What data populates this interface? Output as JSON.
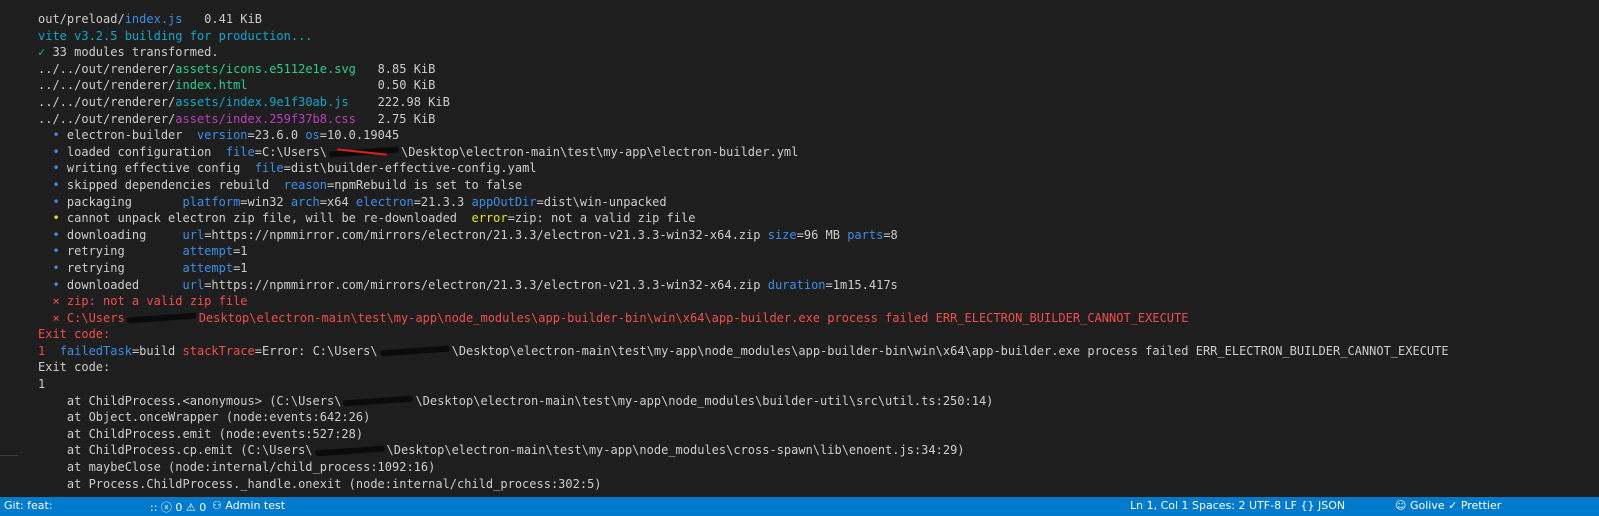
{
  "terminal": {
    "lines": [
      [
        {
          "t": "out/preload/",
          "c": "w"
        },
        {
          "t": "index.js",
          "c": "b"
        },
        {
          "t": "   0.41 KiB",
          "c": "w"
        }
      ],
      [
        {
          "t": "vite v3.2.5 building for production...",
          "c": "c"
        }
      ],
      [
        {
          "t": "✓",
          "c": "gr"
        },
        {
          "t": " 33 modules transformed.",
          "c": "w"
        }
      ],
      [
        {
          "t": "../../out/renderer/",
          "c": "w"
        },
        {
          "t": "assets/icons.e5112e1e.svg",
          "c": "g"
        },
        {
          "t": "   8.85 KiB",
          "c": "w"
        }
      ],
      [
        {
          "t": "../../out/renderer/",
          "c": "w"
        },
        {
          "t": "index.html",
          "c": "g"
        },
        {
          "t": "                  0.50 KiB",
          "c": "w"
        }
      ],
      [
        {
          "t": "../../out/renderer/",
          "c": "w"
        },
        {
          "t": "assets/index.9e1f30ab.js",
          "c": "c"
        },
        {
          "t": "    222.98 KiB",
          "c": "w"
        }
      ],
      [
        {
          "t": "../../out/renderer/",
          "c": "w"
        },
        {
          "t": "assets/index.259f37b8.css",
          "c": "m"
        },
        {
          "t": "   2.75 KiB",
          "c": "w"
        }
      ],
      [
        {
          "t": "  • ",
          "c": "b"
        },
        {
          "t": "electron-builder  ",
          "c": "w"
        },
        {
          "t": "version",
          "c": "b"
        },
        {
          "t": "=23.6.0 ",
          "c": "w"
        },
        {
          "t": "os",
          "c": "b"
        },
        {
          "t": "=10.0.19045",
          "c": "w"
        }
      ],
      [
        {
          "t": "  • ",
          "c": "b"
        },
        {
          "t": "loaded configuration  ",
          "c": "w"
        },
        {
          "t": "file",
          "c": "b"
        },
        {
          "t": "=C:\\Users\\",
          "c": "w"
        },
        {
          "redact": "red"
        },
        {
          "t": "\\Desktop\\electron-main\\test\\my-app\\electron-builder.yml",
          "c": "w"
        }
      ],
      [
        {
          "t": "  • ",
          "c": "b"
        },
        {
          "t": "writing effective config  ",
          "c": "w"
        },
        {
          "t": "file",
          "c": "b"
        },
        {
          "t": "=dist\\builder-effective-config.yaml",
          "c": "w"
        }
      ],
      [
        {
          "t": "  • ",
          "c": "b"
        },
        {
          "t": "skipped dependencies rebuild  ",
          "c": "w"
        },
        {
          "t": "reason",
          "c": "b"
        },
        {
          "t": "=npmRebuild is set to false",
          "c": "w"
        }
      ],
      [
        {
          "t": "  • ",
          "c": "b"
        },
        {
          "t": "packaging       ",
          "c": "w"
        },
        {
          "t": "platform",
          "c": "b"
        },
        {
          "t": "=win32 ",
          "c": "w"
        },
        {
          "t": "arch",
          "c": "b"
        },
        {
          "t": "=x64 ",
          "c": "w"
        },
        {
          "t": "electron",
          "c": "b"
        },
        {
          "t": "=21.3.3 ",
          "c": "w"
        },
        {
          "t": "appOutDir",
          "c": "b"
        },
        {
          "t": "=dist\\win-unpacked",
          "c": "w"
        }
      ],
      [
        {
          "t": "  • ",
          "c": "y"
        },
        {
          "t": "cannot unpack electron zip file, will be re-downloaded  ",
          "c": "w"
        },
        {
          "t": "error",
          "c": "y"
        },
        {
          "t": "=zip: not a valid zip file",
          "c": "w"
        }
      ],
      [
        {
          "t": "  • ",
          "c": "b"
        },
        {
          "t": "downloading     ",
          "c": "w"
        },
        {
          "t": "url",
          "c": "b"
        },
        {
          "t": "=https://npmmirror.com/mirrors/electron/21.3.3/electron-v21.3.3-win32-x64.zip ",
          "c": "w"
        },
        {
          "t": "size",
          "c": "b"
        },
        {
          "t": "=96 MB ",
          "c": "w"
        },
        {
          "t": "parts",
          "c": "b"
        },
        {
          "t": "=8",
          "c": "w"
        }
      ],
      [
        {
          "t": "  • ",
          "c": "b"
        },
        {
          "t": "retrying        ",
          "c": "w"
        },
        {
          "t": "attempt",
          "c": "b"
        },
        {
          "t": "=1",
          "c": "w"
        }
      ],
      [
        {
          "t": "  • ",
          "c": "b"
        },
        {
          "t": "retrying        ",
          "c": "w"
        },
        {
          "t": "attempt",
          "c": "b"
        },
        {
          "t": "=1",
          "c": "w"
        }
      ],
      [
        {
          "t": "  • ",
          "c": "b"
        },
        {
          "t": "downloaded      ",
          "c": "w"
        },
        {
          "t": "url",
          "c": "b"
        },
        {
          "t": "=https://npmmirror.com/mirrors/electron/21.3.3/electron-v21.3.3-win32-x64.zip ",
          "c": "w"
        },
        {
          "t": "duration",
          "c": "b"
        },
        {
          "t": "=1m15.417s",
          "c": "w"
        }
      ],
      [
        {
          "t": "  ⨯ zip: not a valid zip file",
          "c": "r"
        }
      ],
      [
        {
          "t": "  ⨯ C:\\Users",
          "c": "r"
        },
        {
          "redact": "black"
        },
        {
          "t": "Desktop\\electron-main\\test\\my-app\\node_modules\\app-builder-bin\\win\\x64\\app-builder.exe process failed ERR_ELECTRON_BUILDER_CANNOT_EXECUTE",
          "c": "r"
        }
      ],
      [
        {
          "t": "Exit code:",
          "c": "r"
        }
      ],
      [
        {
          "t": "1  ",
          "c": "r"
        },
        {
          "t": "failedTask",
          "c": "b"
        },
        {
          "t": "=build ",
          "c": "w"
        },
        {
          "t": "stackTrace",
          "c": "r"
        },
        {
          "t": "=Error: C:\\Users\\",
          "c": "w"
        },
        {
          "redact": "black"
        },
        {
          "t": "\\Desktop\\electron-main\\test\\my-app\\node_modules\\app-builder-bin\\win\\x64\\app-builder.exe process failed ERR_ELECTRON_BUILDER_CANNOT_EXECUTE",
          "c": "w"
        }
      ],
      [
        {
          "t": "Exit code:",
          "c": "w"
        }
      ],
      [
        {
          "t": "1",
          "c": "w"
        }
      ],
      [
        {
          "t": "    at ChildProcess.<anonymous> (C:\\Users\\",
          "c": "w"
        },
        {
          "redact": "black"
        },
        {
          "t": "\\Desktop\\electron-main\\test\\my-app\\node_modules\\builder-util\\src\\util.ts:250:14)",
          "c": "w"
        }
      ],
      [
        {
          "t": "    at Object.onceWrapper (node:events:642:26)",
          "c": "w"
        }
      ],
      [
        {
          "t": "    at ChildProcess.emit (node:events:527:28)",
          "c": "w"
        }
      ],
      [
        {
          "t": "    at ChildProcess.cp.emit (C:\\Users\\",
          "c": "w"
        },
        {
          "redact": "black"
        },
        {
          "t": "\\Desktop\\electron-main\\test\\my-app\\node_modules\\cross-spawn\\lib\\enoent.js:34:29)",
          "c": "w"
        }
      ],
      [
        {
          "t": "    at maybeClose (node:internal/child_process:1092:16)",
          "c": "w"
        }
      ],
      [
        {
          "t": "    at Process.ChildProcess._handle.onexit (node:internal/child_process:302:5)",
          "c": "w"
        }
      ]
    ]
  },
  "status_bar": {
    "items_left": [
      "Git: feat: ",
      ":: ⓧ 0 ⚠ 0",
      "⚇ Admin  test"
    ],
    "items_right": [
      "Ln 1, Col 1  Spaces: 2  UTF-8  LF  {} JSON",
      "☺ Golive  ✓ Prettier"
    ]
  },
  "colors": {
    "terminal_bg": "#1e1e1e",
    "status_bg": "#007acc"
  }
}
